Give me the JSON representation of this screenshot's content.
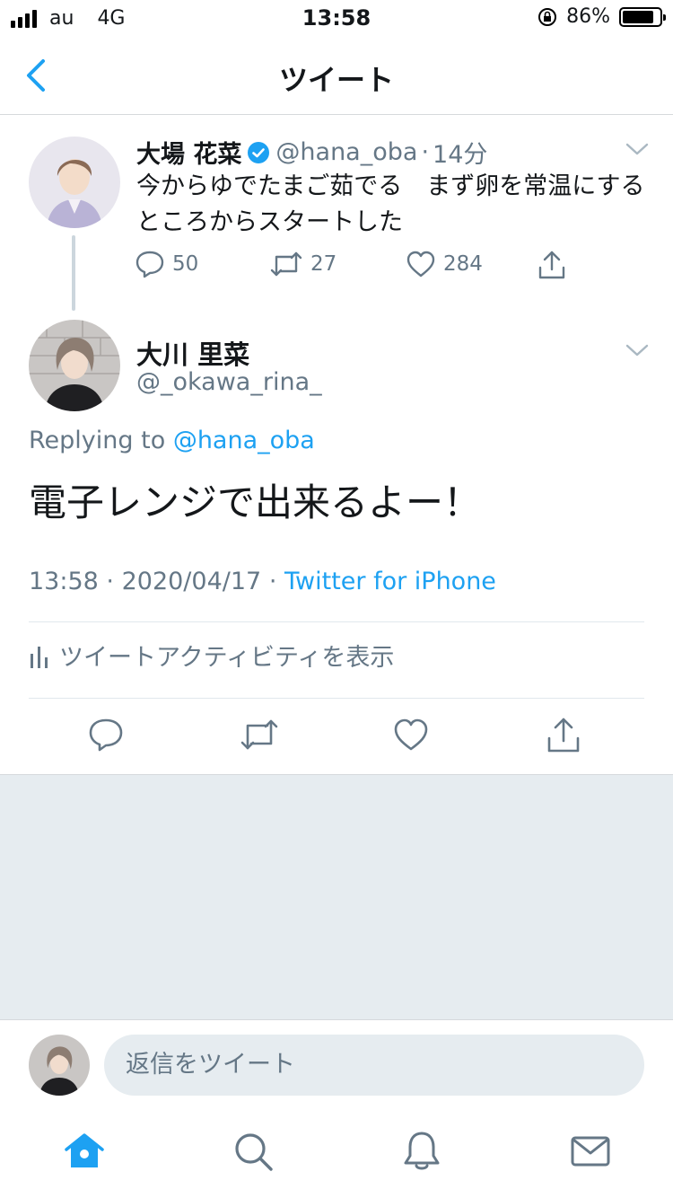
{
  "status_bar": {
    "carrier": "au",
    "network": "4G",
    "time": "13:58",
    "battery_percent": "86%",
    "battery_level": 0.86
  },
  "nav": {
    "title": "ツイート"
  },
  "parent_tweet": {
    "name": "大場 花菜",
    "handle": "@hana_oba",
    "separator": "·",
    "time_ago": "14分",
    "text": "今からゆでたまご茹でる　まず卵を常温にするところからスタートした",
    "replies": "50",
    "retweets": "27",
    "likes": "284"
  },
  "main_tweet": {
    "name": "大川 里菜",
    "handle": "@_okawa_rina_",
    "replying_prefix": "Replying to",
    "replying_handle": "@hana_oba",
    "text": "電子レンジで出来るよー！",
    "time": "13:58",
    "separator1": "·",
    "date": "2020/04/17",
    "separator2": "·",
    "source": "Twitter for iPhone",
    "activity_label": "ツイートアクティビティを表示"
  },
  "reply_bar": {
    "placeholder": "返信をツイート"
  },
  "colors": {
    "accent": "#1da1f2",
    "muted": "#657786",
    "divider": "#e1e8ed",
    "background_gray": "#e6ecf0"
  },
  "icons": {
    "back": "chevron-left-icon",
    "verified": "verified-badge-icon",
    "reply": "reply-icon",
    "retweet": "retweet-icon",
    "like": "heart-icon",
    "share": "share-icon",
    "home": "home-icon",
    "search": "search-icon",
    "notifications": "bell-icon",
    "messages": "mail-icon"
  }
}
